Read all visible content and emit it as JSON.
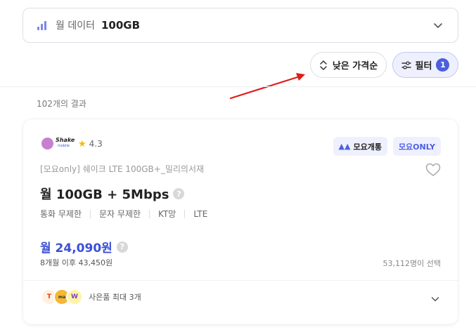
{
  "data_selector": {
    "label": "월 데이터",
    "value": "100GB",
    "icon": "signal-bars-icon"
  },
  "toolbar": {
    "sort_label": "낮은 가격순",
    "filter_label": "필터",
    "filter_count": "1"
  },
  "results": {
    "count_text": "102개의 결과"
  },
  "plan": {
    "brand_line1": "Shake",
    "brand_line2": "mobile",
    "rating": "4.3",
    "badge_mobile": "모요개통",
    "badge_only": "모요ONLY",
    "subtitle": "[모요only] 쉐이크 LTE 100GB+_밀리의서재",
    "title": "월 100GB + 5Mbps",
    "features": [
      "통화 무제한",
      "문자 무제한",
      "KT망",
      "LTE"
    ],
    "price": "월 24,090원",
    "price_note": "8개월 이후 43,450원",
    "selected_count": "53,112명이 선택",
    "gifts_label": "사은품 최대 3개",
    "gift_icons": [
      "T",
      "ma",
      "W"
    ]
  },
  "colors": {
    "accent": "#4c5fe0",
    "price": "#3b4fd6",
    "annotation_arrow": "#e01b1b"
  }
}
